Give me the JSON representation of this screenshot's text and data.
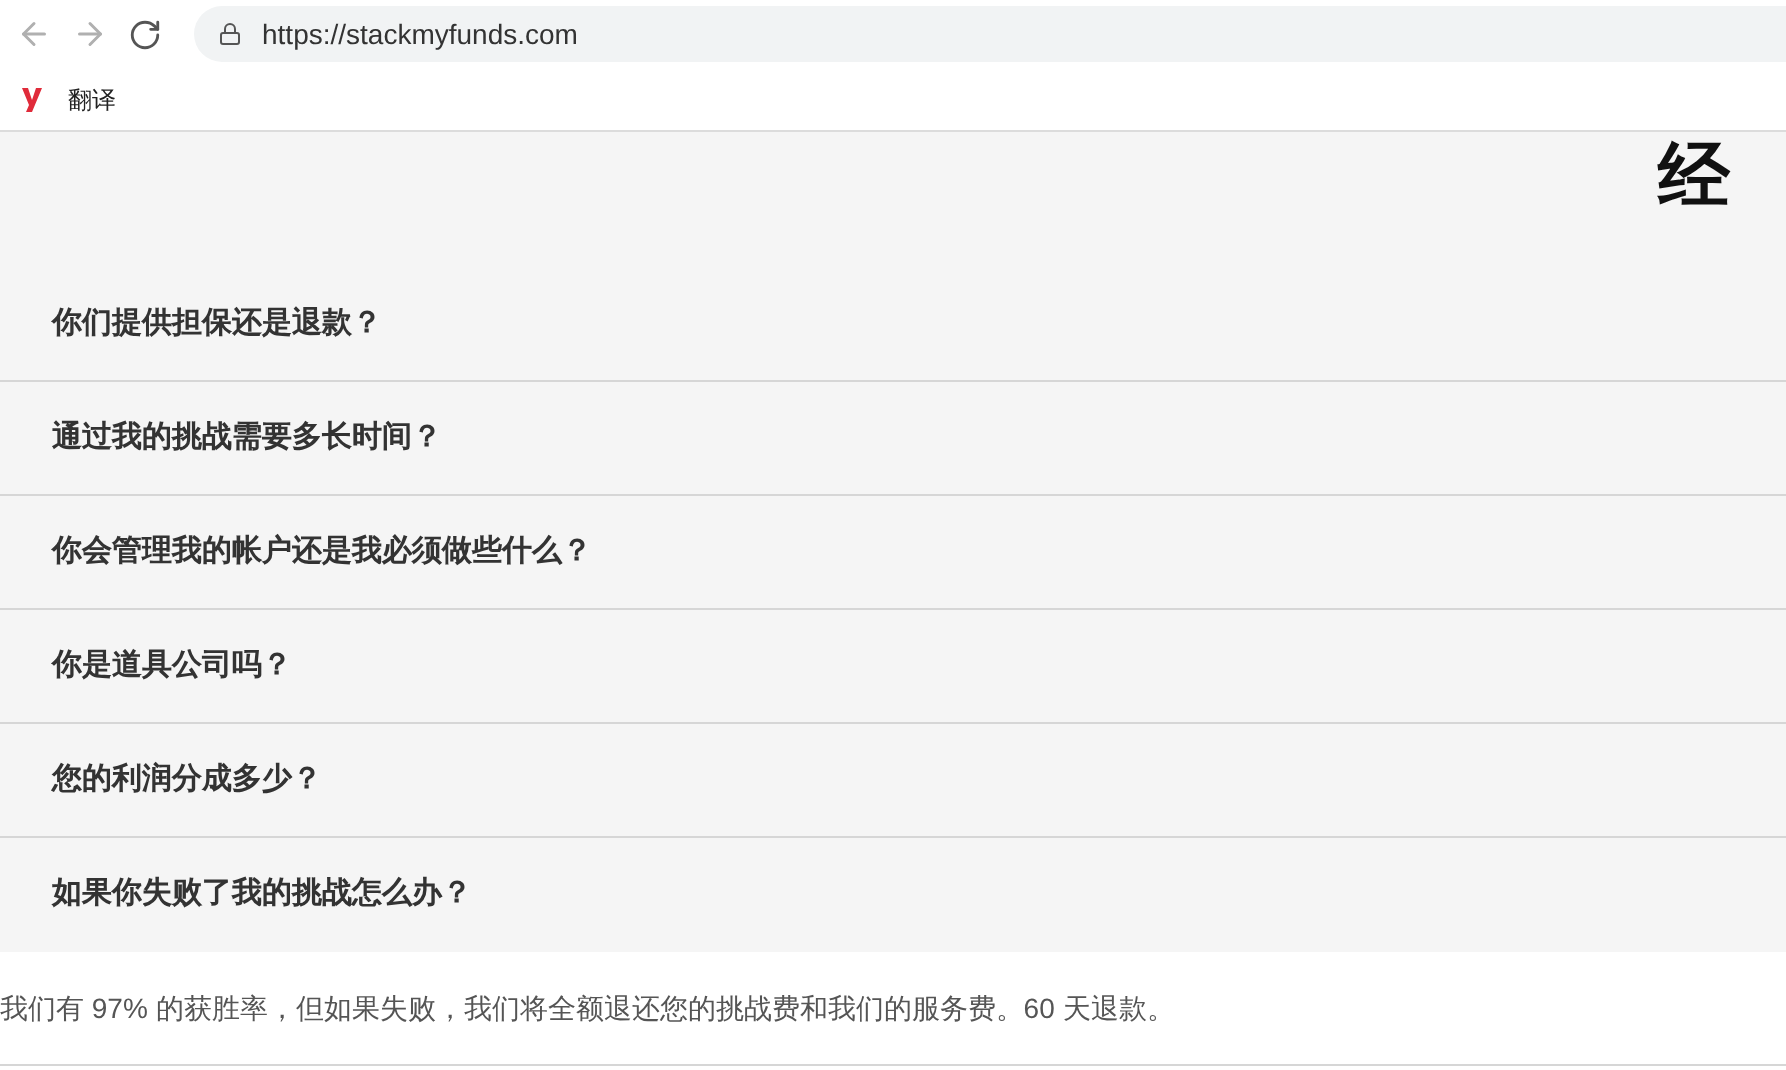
{
  "browser": {
    "url": "https://stackmyfunds.com",
    "bookmarks": [
      {
        "label": "翻译"
      }
    ]
  },
  "page": {
    "heading": "经",
    "faq": [
      {
        "question": "你们提供担保还是退款？",
        "expanded": false
      },
      {
        "question": "通过我的挑战需要多长时间？",
        "expanded": false
      },
      {
        "question": "你会管理我的帐户还是我必须做些什么？",
        "expanded": false
      },
      {
        "question": "你是道具公司吗？",
        "expanded": false
      },
      {
        "question": "您的利润分成多少？",
        "expanded": false
      },
      {
        "question": "如果你失败了我的挑战怎么办？",
        "expanded": true,
        "answer": "我们有 97% 的获胜率，但如果失败，我们将全额退还您的挑战费和我们的服务费。60 天退款。"
      }
    ]
  }
}
